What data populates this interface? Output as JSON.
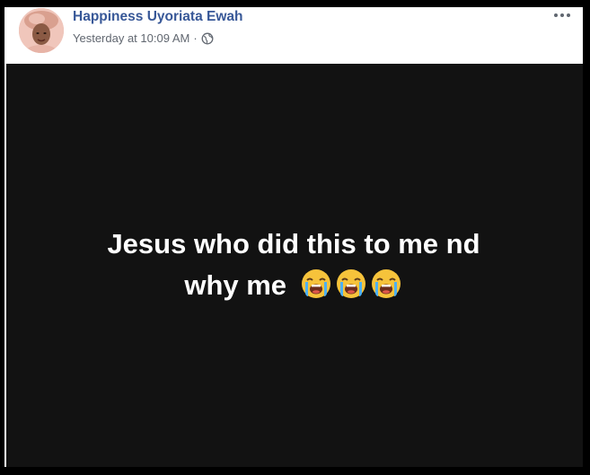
{
  "post": {
    "author": "Happiness Uyoriata Ewah",
    "timestamp": "Yesterday at 10:09 AM",
    "separator": "·",
    "privacy_icon": "globe-icon",
    "menu_icon": "more-options-icon",
    "text_line1": "Jesus who did this to me nd",
    "text_line2": "why me",
    "emojis": [
      "loudly-crying-face-icon",
      "loudly-crying-face-icon",
      "loudly-crying-face-icon"
    ]
  },
  "colors": {
    "author_link": "#385898",
    "meta_text": "#616770",
    "post_background": "#121212",
    "post_text": "#ffffff"
  }
}
